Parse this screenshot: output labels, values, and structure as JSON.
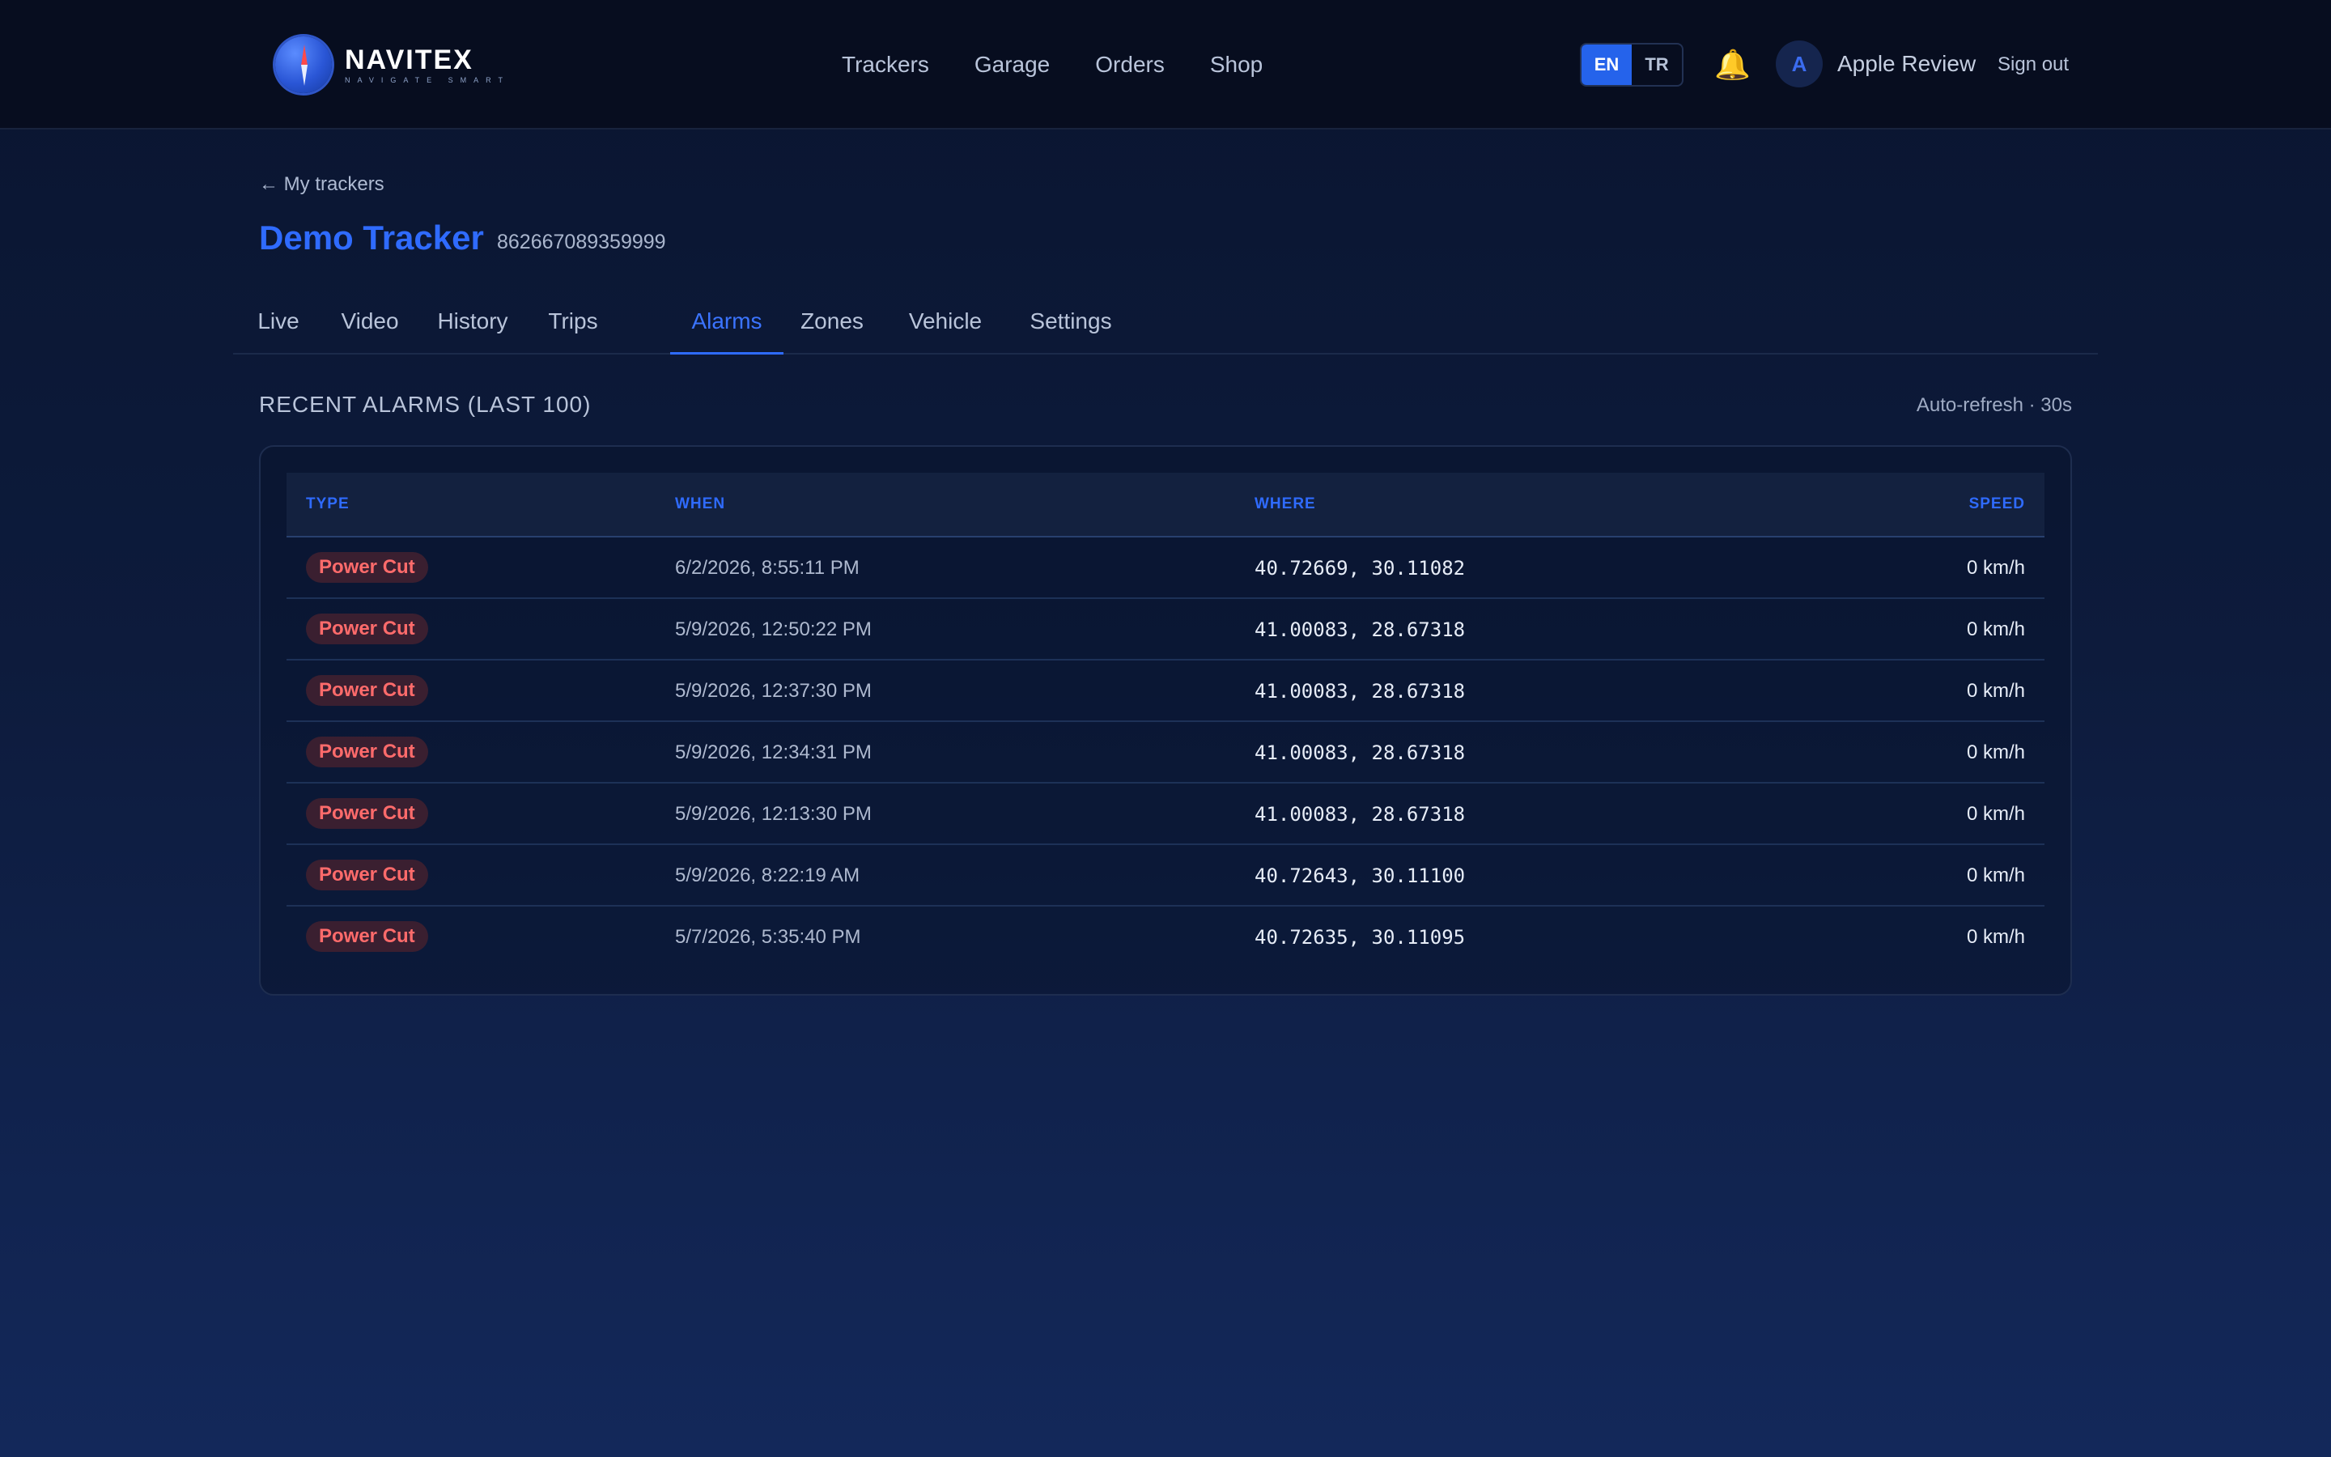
{
  "brand": {
    "name": "NAVITEX",
    "tagline": "NAVIGATE SMART",
    "logo_icon": "compass-globe-icon"
  },
  "nav": {
    "items": [
      "Trackers",
      "Garage",
      "Orders",
      "Shop"
    ]
  },
  "language": {
    "options": [
      "EN",
      "TR"
    ],
    "selected": "EN"
  },
  "notifications": {
    "icon": "bell-icon",
    "color": "#fbbf24"
  },
  "user": {
    "initial": "A",
    "name": "Apple Review",
    "signout_label": "Sign out"
  },
  "page": {
    "back_label": "My trackers",
    "tracker_name": "Demo Tracker",
    "tracker_id": "862667089359999",
    "accent": "#2f6bff"
  },
  "tabs": {
    "items": [
      "Live",
      "Video",
      "History",
      "Trips",
      "Alarms",
      "Zones",
      "Vehicle",
      "Settings"
    ],
    "active": "Alarms"
  },
  "alarms": {
    "heading": "RECENT ALARMS (LAST 100)",
    "refresh": "Auto-refresh · 30s",
    "columns": {
      "type": "TYPE",
      "when": "WHEN",
      "where": "WHERE",
      "speed": "SPEED"
    },
    "rows": [
      {
        "type": "Power Cut",
        "when": "6/2/2026, 8:55:11 PM",
        "where": "40.72669, 30.11082",
        "speed": "0 km/h"
      },
      {
        "type": "Power Cut",
        "when": "5/9/2026, 12:50:22 PM",
        "where": "41.00083, 28.67318",
        "speed": "0 km/h"
      },
      {
        "type": "Power Cut",
        "when": "5/9/2026, 12:37:30 PM",
        "where": "41.00083, 28.67318",
        "speed": "0 km/h"
      },
      {
        "type": "Power Cut",
        "when": "5/9/2026, 12:34:31 PM",
        "where": "41.00083, 28.67318",
        "speed": "0 km/h"
      },
      {
        "type": "Power Cut",
        "when": "5/9/2026, 12:13:30 PM",
        "where": "41.00083, 28.67318",
        "speed": "0 km/h"
      },
      {
        "type": "Power Cut",
        "when": "5/9/2026, 8:22:19 AM",
        "where": "40.72643, 30.11100",
        "speed": "0 km/h"
      },
      {
        "type": "Power Cut",
        "when": "5/7/2026, 5:35:40 PM",
        "where": "40.72635, 30.11095",
        "speed": "0 km/h"
      }
    ],
    "badge_color": "#ff6b6b"
  }
}
